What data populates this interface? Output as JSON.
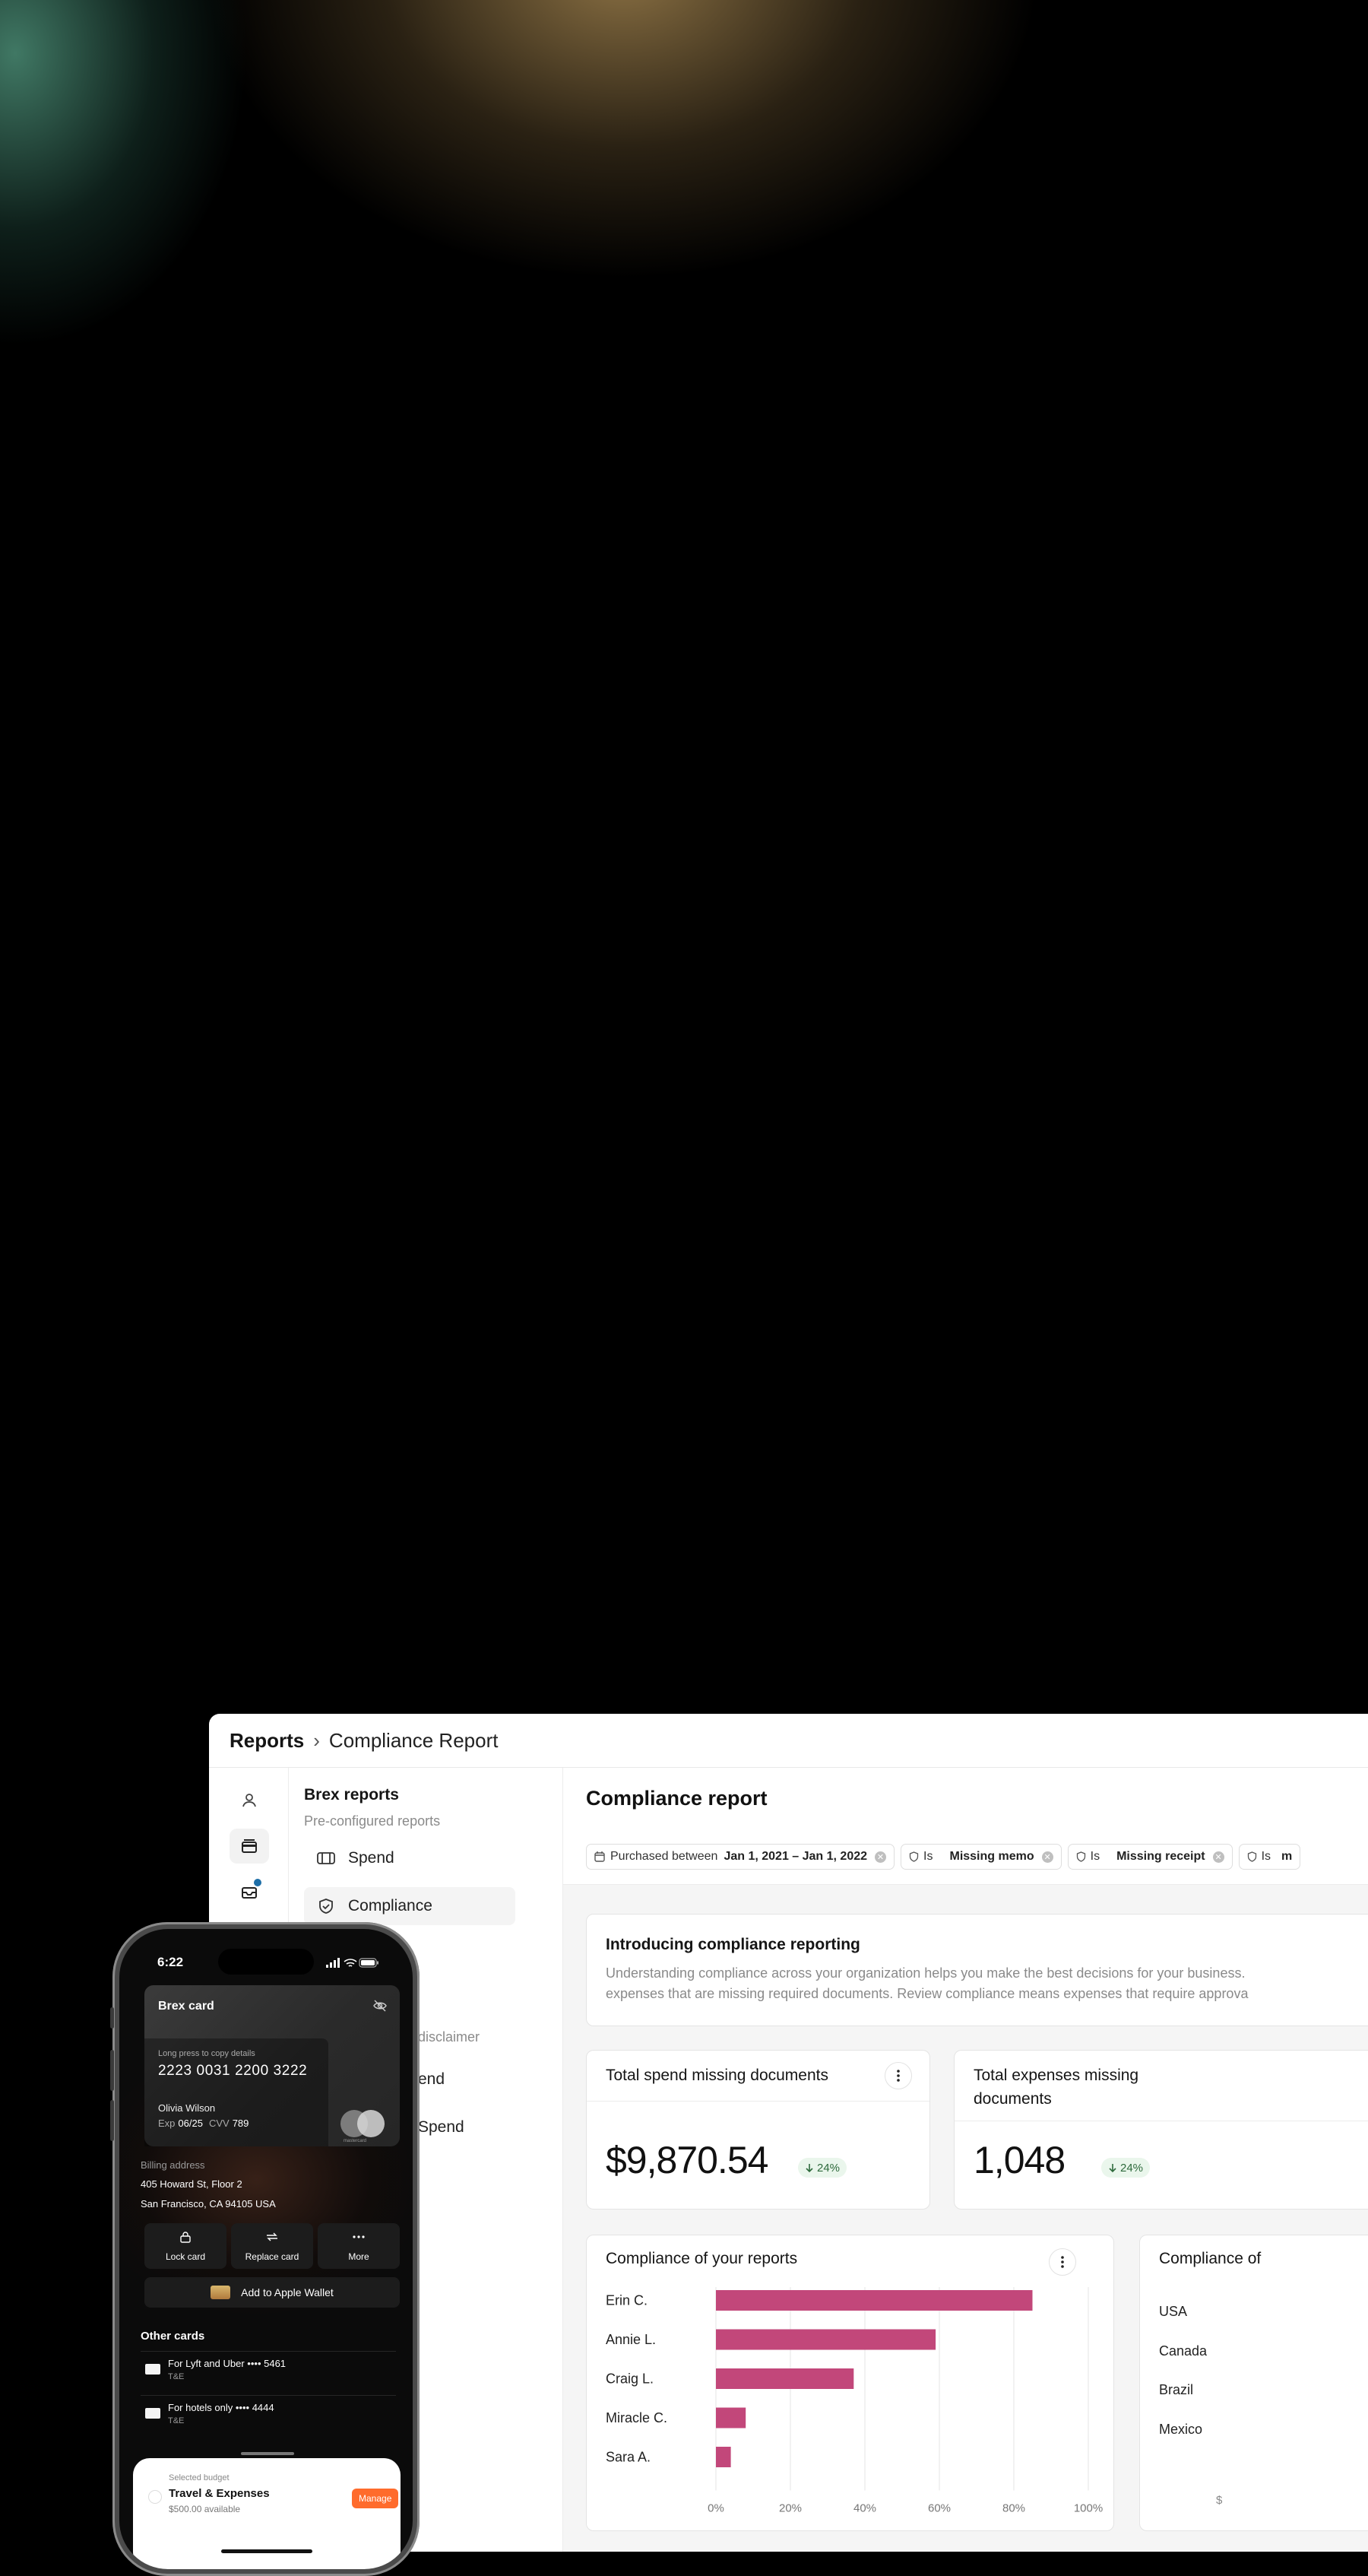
{
  "window": {
    "breadcrumb": {
      "root": "Reports",
      "separator": "›",
      "current": "Compliance Report"
    },
    "rail": {
      "items": [
        "person-icon",
        "reports-icon",
        "inbox-icon"
      ]
    },
    "side_panel": {
      "title": "Brex reports",
      "subtitle": "Pre-configured reports",
      "items": [
        {
          "label": "Spend",
          "icon": "card-stack-icon"
        },
        {
          "label": "Compliance",
          "icon": "shield-check-icon",
          "active": true
        }
      ],
      "partially_visible": [
        "disclaimer",
        "end",
        "Spend"
      ]
    },
    "main": {
      "title": "Compliance report",
      "filters": [
        {
          "field": "Purchased between",
          "value": "Jan 1, 2021 – Jan 1, 2022"
        },
        {
          "field": "Is",
          "value": "Missing memo"
        },
        {
          "field": "Is",
          "value": "Missing receipt"
        },
        {
          "field": "Is",
          "value": "m"
        }
      ],
      "intro": {
        "title": "Introducing compliance reporting",
        "line1": "Understanding compliance across your organization helps you make the best decisions for your business.",
        "line2": "expenses that are missing required documents. Review compliance means expenses that require approva"
      },
      "kpis": [
        {
          "title": "Total spend missing documents",
          "value": "$9,870.54",
          "change": "24%"
        },
        {
          "title_line1": "Total expenses missing",
          "title_line2": "documents",
          "value": "1,048",
          "change": "24%"
        }
      ],
      "chart_cards": {
        "left_title": "Compliance of your reports",
        "right_title": "Compliance of",
        "right_rows": [
          "USA",
          "Canada",
          "Brazil",
          "Mexico"
        ],
        "right_axis_fragment": "$"
      }
    }
  },
  "chart_data": {
    "type": "bar",
    "orientation": "horizontal",
    "title": "Compliance of your reports",
    "categories": [
      "Erin C.",
      "Annie L.",
      "Craig L.",
      "Miracle C.",
      "Sara A."
    ],
    "values": [
      85,
      59,
      37,
      8,
      4
    ],
    "xlim": [
      0,
      100
    ],
    "x_ticks": [
      "0%",
      "20%",
      "40%",
      "60%",
      "80%",
      "100%"
    ],
    "grid": true,
    "bar_color": "#c2477a"
  },
  "phone": {
    "time": "6:22",
    "card": {
      "title": "Brex card",
      "hint": "Long press to copy details",
      "number": "2223 0031 2200 3222",
      "name": "Olivia Wilson",
      "exp_label": "Exp",
      "exp": "06/25",
      "cvv_label": "CVV",
      "cvv": "789",
      "network": "mastercard"
    },
    "billing": {
      "label": "Billing address",
      "line1": "405 Howard St, Floor 2",
      "line2": "San Francisco, CA 94105 USA"
    },
    "actions": [
      "Lock card",
      "Replace card",
      "More"
    ],
    "wallet": "Add to Apple Wallet",
    "other_cards": {
      "title": "Other cards",
      "items": [
        {
          "name": "For Lyft and Uber •••• 5461",
          "tag": "T&E"
        },
        {
          "name": "For hotels only •••• 4444",
          "tag": "T&E"
        }
      ]
    },
    "budget": {
      "label": "Selected budget",
      "name": "Travel & Expenses",
      "available": "$500.00 available",
      "button": "Manage"
    }
  },
  "colors": {
    "accent_orange": "#ff6b2c",
    "bar": "#c2477a",
    "positive_badge": "#2e6a3c"
  }
}
